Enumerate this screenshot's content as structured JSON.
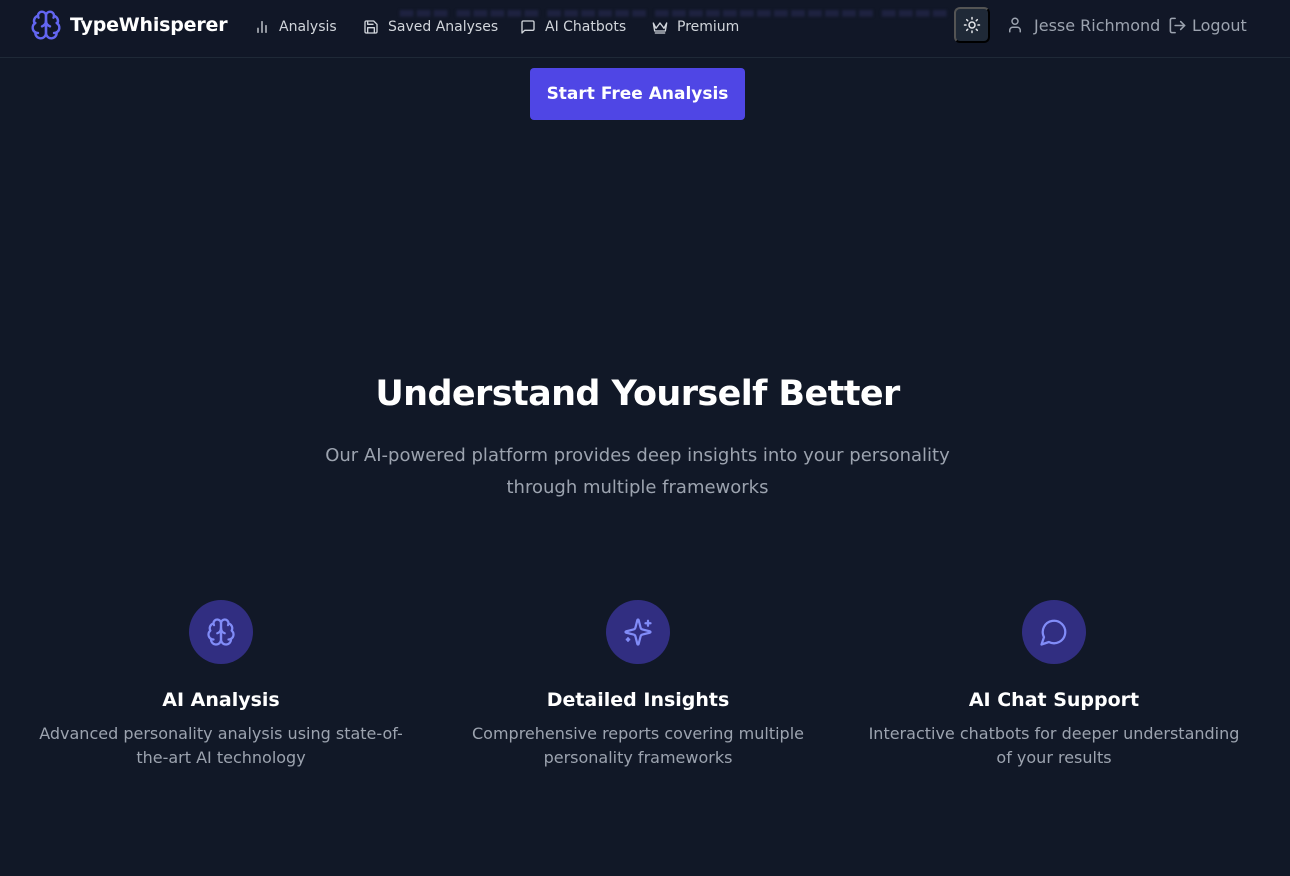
{
  "app": {
    "name": "TypeWhisperer"
  },
  "nav": {
    "items": [
      {
        "label": "Analysis",
        "icon": "bar-chart-icon"
      },
      {
        "label": "Saved Analyses",
        "icon": "save-icon"
      },
      {
        "label": "AI Chatbots",
        "icon": "message-square-icon"
      },
      {
        "label": "Premium",
        "icon": "crown-icon"
      }
    ],
    "theme_toggle_icon": "sun-icon",
    "user_name": "Jesse Richmond",
    "logout_label": "Logout"
  },
  "hero": {
    "cta_label": "Start Free Analysis"
  },
  "features_section": {
    "title": "Understand Yourself Better",
    "description": "Our AI-powered platform provides deep insights into your personality through multiple frameworks",
    "features": [
      {
        "icon": "brain-icon",
        "title": "AI Analysis",
        "description": "Advanced personality analysis using state-of-the-art AI technology"
      },
      {
        "icon": "sparkles-icon",
        "title": "Detailed Insights",
        "description": "Comprehensive reports covering multiple personality frameworks"
      },
      {
        "icon": "message-circle-icon",
        "title": "AI Chat Support",
        "description": "Interactive chatbots for deeper understanding of your results"
      }
    ]
  },
  "colors": {
    "background": "#111827",
    "accent": "#4f46e5",
    "accent_soft": "#312e81",
    "icon_accent": "#818cf8",
    "muted_text": "#9ca3af"
  }
}
